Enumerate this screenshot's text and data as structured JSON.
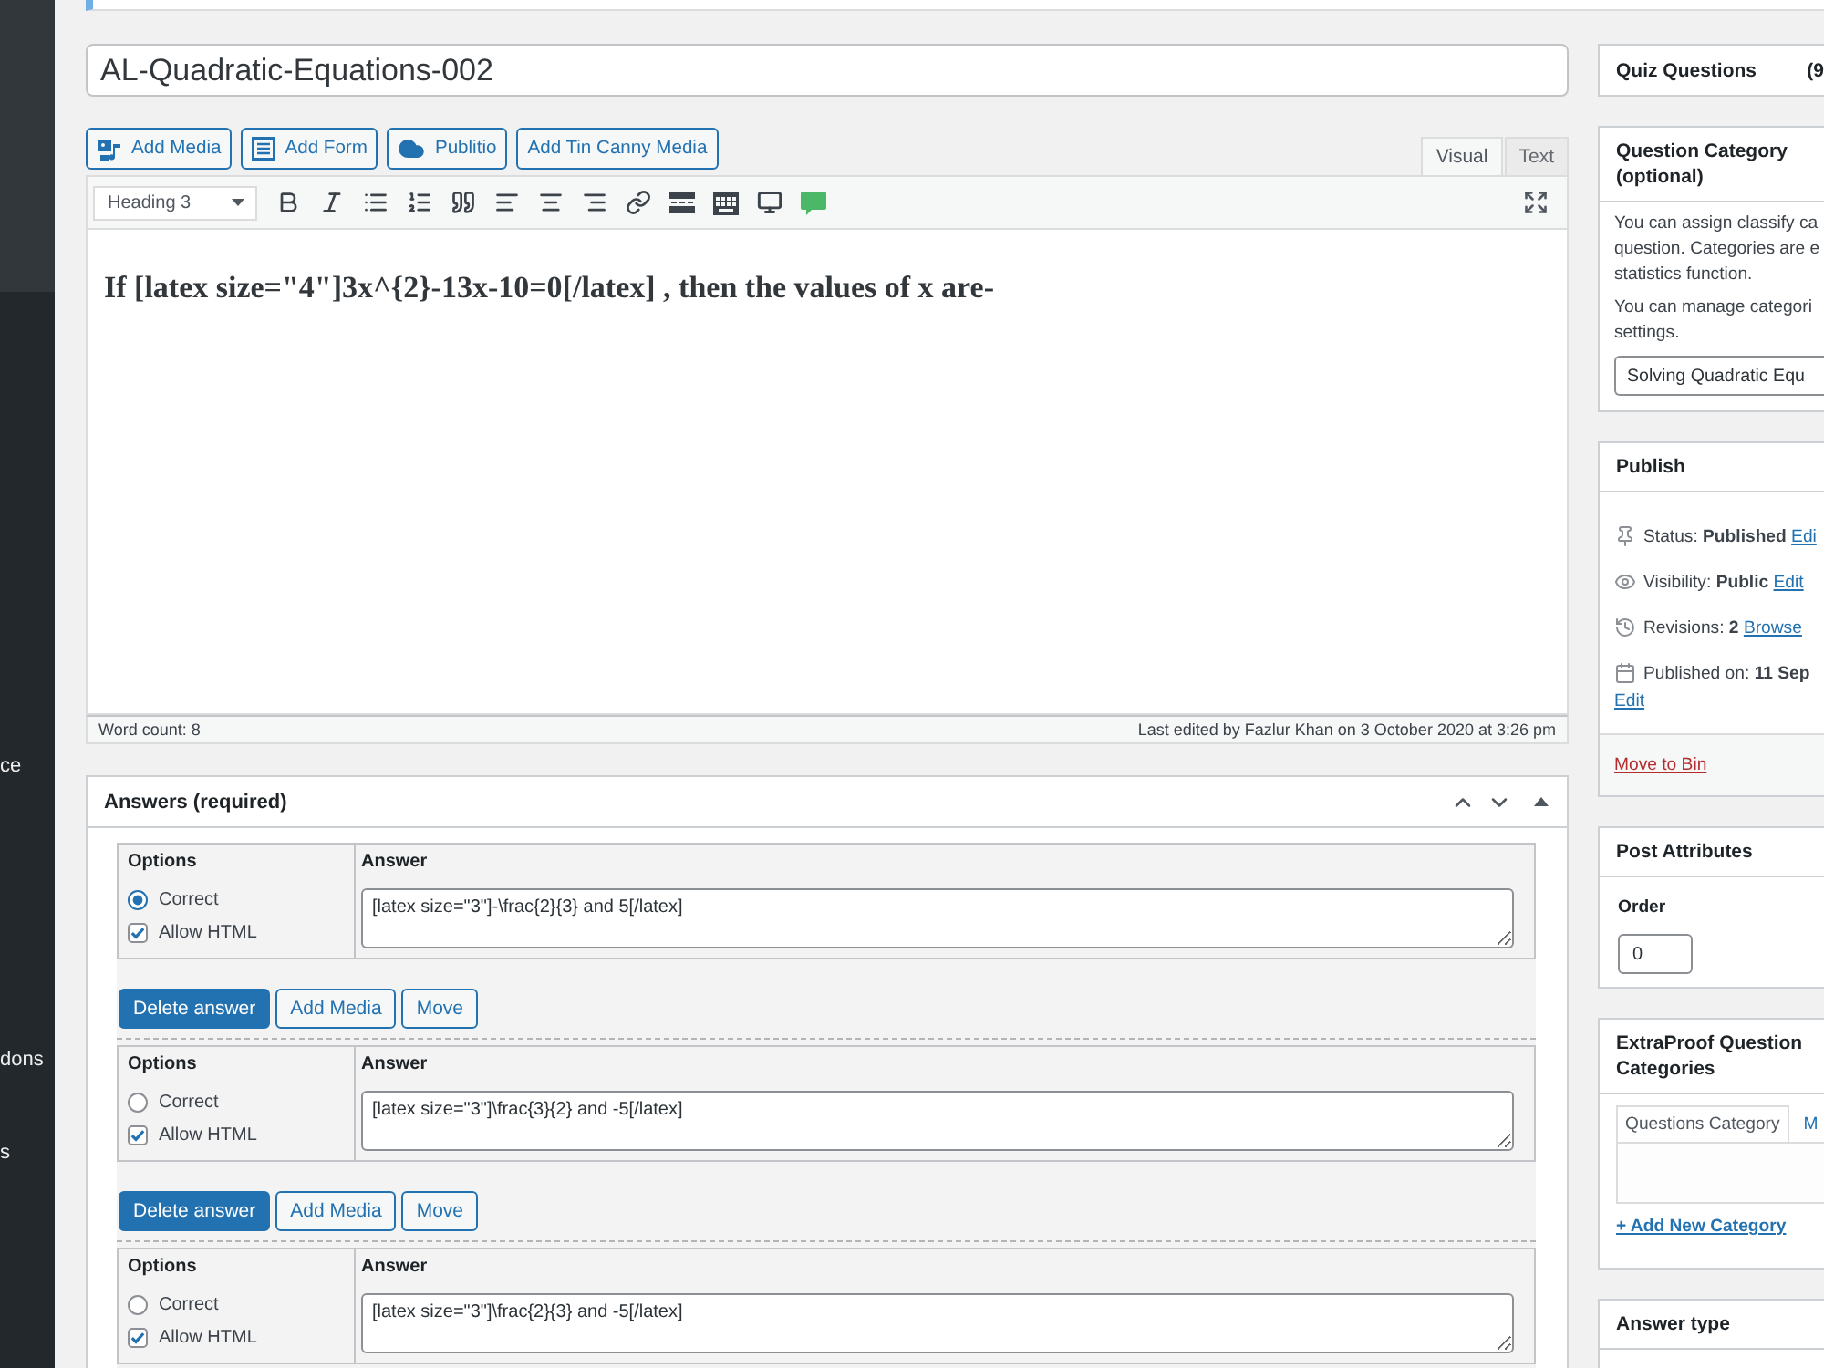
{
  "sidebar": {
    "items": [
      {
        "label": "ce"
      },
      {
        "label": "dons"
      },
      {
        "label": "s"
      }
    ]
  },
  "title_field": {
    "value": "AL-Quadratic-Equations-002"
  },
  "media_buttons": [
    {
      "label": "Add Media",
      "kind": "media"
    },
    {
      "label": "Add Form",
      "kind": "form"
    },
    {
      "label": "Publitio",
      "kind": "cloud"
    },
    {
      "label": "Add Tin Canny Media",
      "kind": "plain"
    }
  ],
  "editor_tabs": [
    {
      "label": "Visual",
      "selected": true
    },
    {
      "label": "Text",
      "selected": false
    }
  ],
  "toolbar": {
    "format": "Heading 3"
  },
  "content": "If [latex size=\"4\"]3x^{2}-13x-10=0[/latex] , then the values of x are-",
  "status_bar": {
    "word_count": "Word count: 8",
    "last_edited": "Last edited by Fazlur Khan on 3 October 2020 at 3:26 pm"
  },
  "answers_box": {
    "title": "Answers (required)",
    "answers": [
      {
        "options_heading": "Options",
        "answer_heading": "Answer",
        "correct": {
          "label": "Correct",
          "selected": true
        },
        "allow_html": {
          "label": "Allow HTML",
          "checked": true
        },
        "value": "[latex size=\"3\"]-\\frac{2}{3} and 5[/latex]",
        "buttons": [
          {
            "label": "Delete answer",
            "kind": "primary"
          },
          {
            "label": "Add Media",
            "kind": "secondary"
          },
          {
            "label": "Move",
            "kind": "secondary"
          }
        ]
      },
      {
        "options_heading": "Options",
        "answer_heading": "Answer",
        "correct": {
          "label": "Correct",
          "selected": false
        },
        "allow_html": {
          "label": "Allow HTML",
          "checked": true
        },
        "value": "[latex size=\"3\"]\\frac{3}{2} and -5[/latex]",
        "buttons": [
          {
            "label": "Delete answer",
            "kind": "primary"
          },
          {
            "label": "Add Media",
            "kind": "secondary"
          },
          {
            "label": "Move",
            "kind": "secondary"
          }
        ]
      },
      {
        "options_heading": "Options",
        "answer_heading": "Answer",
        "correct": {
          "label": "Correct",
          "selected": false
        },
        "allow_html": {
          "label": "Allow HTML",
          "checked": true
        },
        "value": "[latex size=\"3\"]\\frac{2}{3} and -5[/latex]"
      }
    ]
  },
  "quiz_questions": {
    "title": "Quiz Questions",
    "count": "(9"
  },
  "question_category": {
    "title": "Question Category (optional)",
    "description_lines": [
      "You can assign classify ca",
      "question. Categories are e",
      "statistics function."
    ],
    "manage_lines": [
      "You can manage categori",
      "settings."
    ],
    "selected_category": "Solving Quadratic Equ"
  },
  "publish": {
    "title": "Publish",
    "rows": [
      {
        "kind": "status",
        "text": "Status: **Published**",
        "link": "Edi"
      },
      {
        "kind": "visibility",
        "text": "Visibility: **Public**",
        "link": "Edit"
      },
      {
        "kind": "revisions",
        "text": "Revisions: **2**",
        "link": "Browse"
      },
      {
        "kind": "date",
        "text": "Published on: **11 Sep**",
        "link": "Edit"
      }
    ],
    "delete_link": "Move to Bin"
  },
  "post_attributes": {
    "title": "Post Attributes",
    "order_label": "Order",
    "order_value": "0"
  },
  "extraproof_categories": {
    "title": "ExtraProof Question Categories",
    "tabs": [
      {
        "label": "Questions Category",
        "selected": true
      },
      {
        "label": "M",
        "selected": false
      }
    ],
    "add_link": "+ Add New Category"
  },
  "answer_type": {
    "title": "Answer type"
  }
}
